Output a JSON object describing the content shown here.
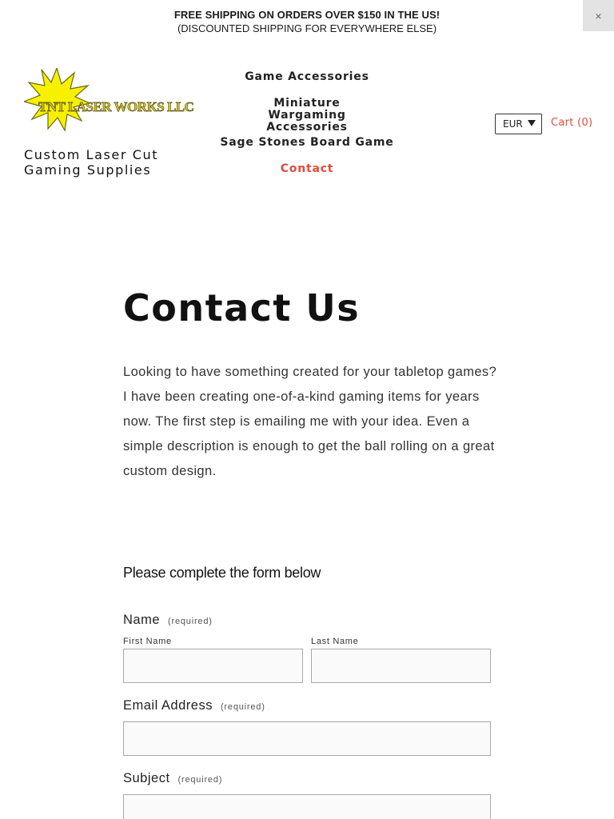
{
  "announcement": {
    "line1": "FREE SHIPPING ON ORDERS OVER $150 IN THE US!",
    "line2": "(DISCOUNTED SHIPPING FOR EVERYWHERE ELSE)",
    "close_label": "×"
  },
  "header": {
    "logo_text": "TNT LASER WORKS LLC",
    "tagline": "Custom Laser Cut Gaming Supplies",
    "nav": [
      {
        "label": "Game Accessories"
      },
      {
        "label": "Miniature Wargaming Accessories"
      },
      {
        "label": "Sage Stones Board Game"
      },
      {
        "label": "Contact"
      }
    ],
    "currency": "EUR",
    "cart_label": "Cart (0)"
  },
  "main": {
    "title": "Contact Us",
    "intro": "Looking to have something created for your tabletop games? I have been creating one-of-a-kind gaming items for years now. The first step is emailing me with your idea. Even a simple description is enough to get the ball rolling on a great custom design."
  },
  "form": {
    "heading": "Please complete the form below",
    "required_text": "(required)",
    "name": {
      "label": "Name",
      "first_label": "First Name",
      "last_label": "Last Name",
      "first_value": "",
      "last_value": ""
    },
    "email": {
      "label": "Email Address",
      "value": ""
    },
    "subject": {
      "label": "Subject",
      "value": ""
    }
  },
  "colors": {
    "accent": "#e14b3c",
    "close_bg": "#e3e3e3",
    "logo_yellow": "#f7f000"
  }
}
